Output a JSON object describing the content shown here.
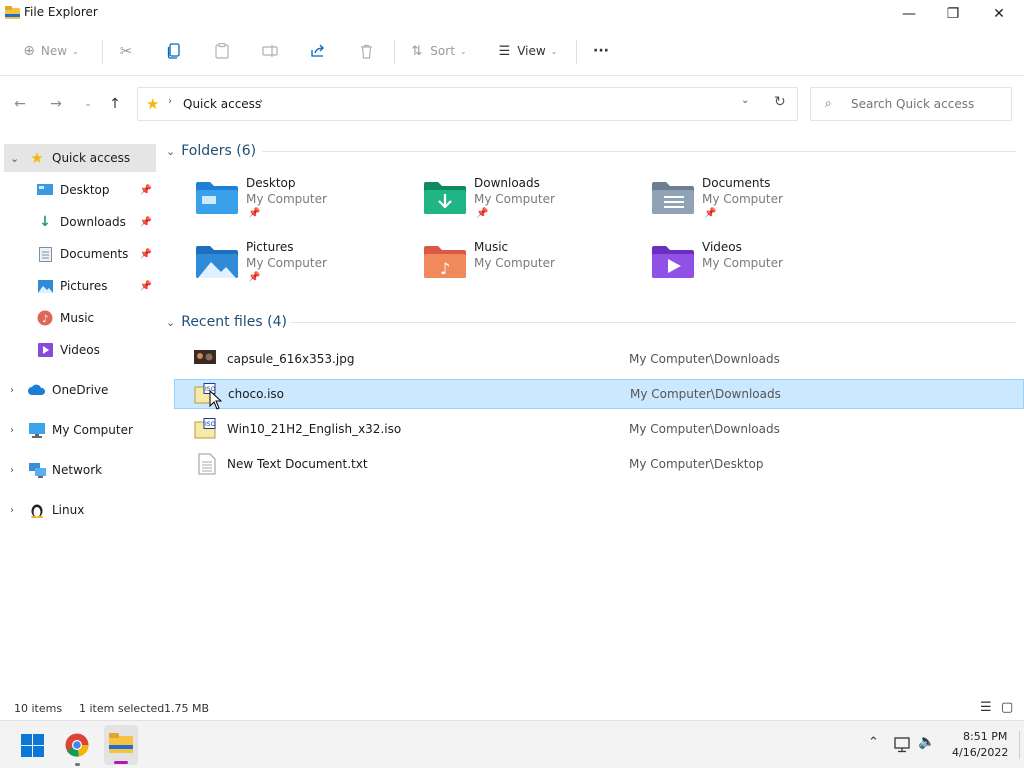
{
  "window": {
    "title": "File Explorer",
    "minimize_label": "—",
    "maximize_label": "❐",
    "close_label": "✕"
  },
  "toolbar": {
    "new_label": "New",
    "sort_label": "Sort",
    "view_label": "View",
    "more_label": "···"
  },
  "address": {
    "location": "Quick access",
    "search_placeholder": "Search Quick access"
  },
  "sidebar": {
    "items": [
      {
        "label": "Quick access",
        "icon": "star-icon"
      },
      {
        "label": "Desktop",
        "icon": "desktop-icon"
      },
      {
        "label": "Downloads",
        "icon": "download-icon"
      },
      {
        "label": "Documents",
        "icon": "document-icon"
      },
      {
        "label": "Pictures",
        "icon": "pictures-icon"
      },
      {
        "label": "Music",
        "icon": "music-icon"
      },
      {
        "label": "Videos",
        "icon": "videos-icon"
      },
      {
        "label": "OneDrive",
        "icon": "cloud-icon"
      },
      {
        "label": "My Computer",
        "icon": "computer-icon"
      },
      {
        "label": "Network",
        "icon": "network-icon"
      },
      {
        "label": "Linux",
        "icon": "linux-icon"
      }
    ]
  },
  "folders": {
    "heading": "Folders (6)",
    "items": [
      {
        "name": "Desktop",
        "location": "My Computer"
      },
      {
        "name": "Downloads",
        "location": "My Computer"
      },
      {
        "name": "Documents",
        "location": "My Computer"
      },
      {
        "name": "Pictures",
        "location": "My Computer"
      },
      {
        "name": "Music",
        "location": "My Computer"
      },
      {
        "name": "Videos",
        "location": "My Computer"
      }
    ]
  },
  "recent": {
    "heading": "Recent files (4)",
    "items": [
      {
        "name": "capsule_616x353.jpg",
        "path": "My Computer\\Downloads"
      },
      {
        "name": "choco.iso",
        "path": "My Computer\\Downloads"
      },
      {
        "name": "Win10_21H2_English_x32.iso",
        "path": "My Computer\\Downloads"
      },
      {
        "name": "New Text Document.txt",
        "path": "My Computer\\Desktop"
      }
    ]
  },
  "status": {
    "count": "10 items",
    "selection": "1 item selected",
    "size": "1.75 MB"
  },
  "taskbar": {
    "time": "8:51 PM",
    "date": "4/16/2022"
  },
  "colors": {
    "accent": "#0067c0",
    "selected_row": "#cce8ff"
  }
}
